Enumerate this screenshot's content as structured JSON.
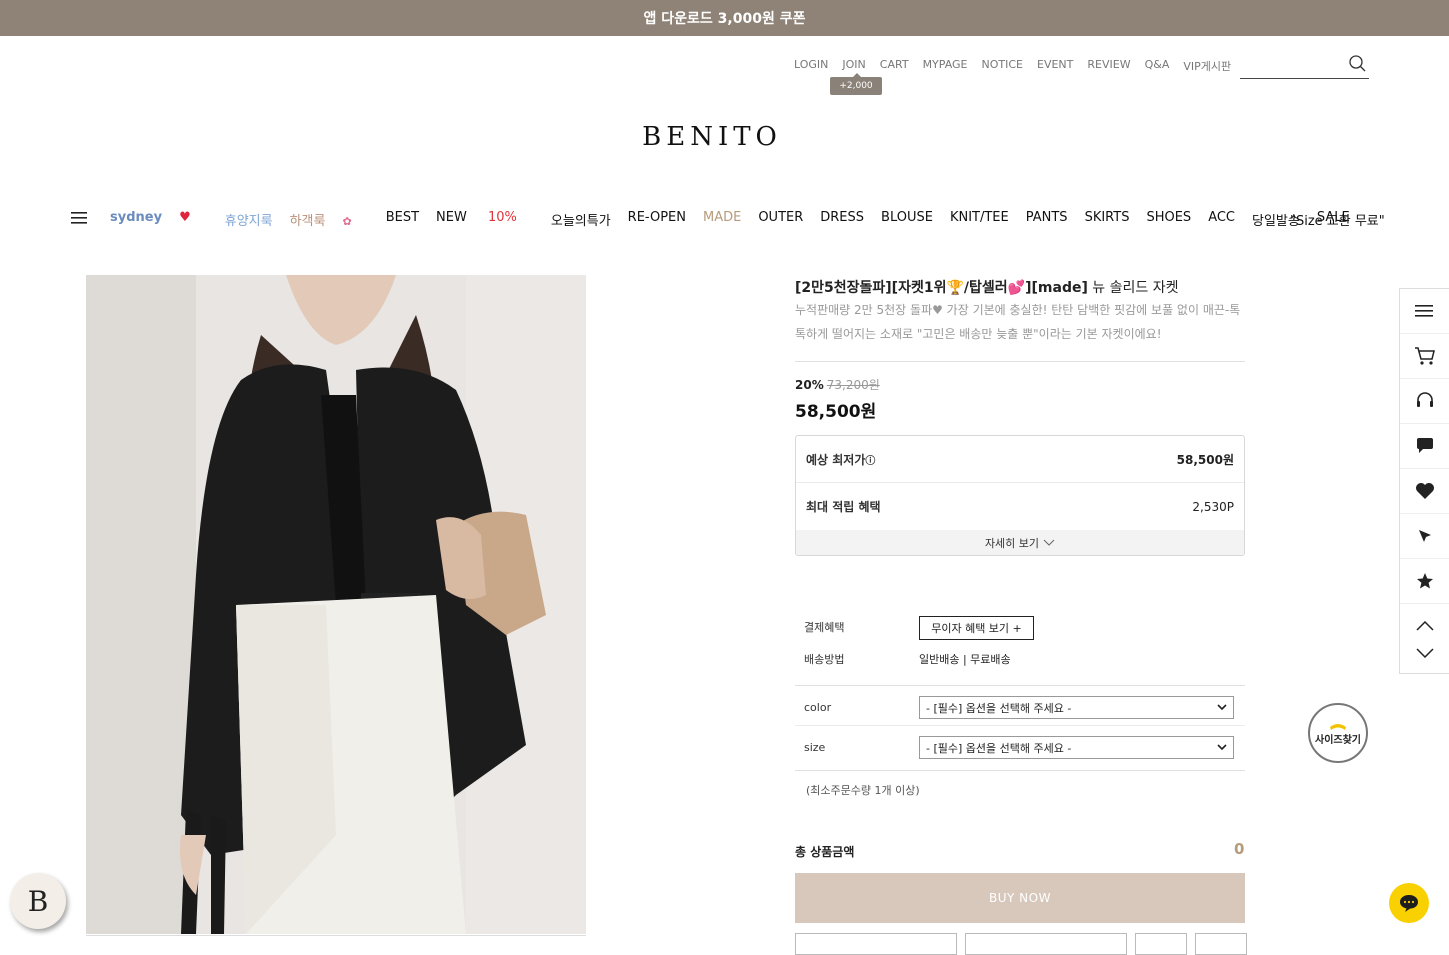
{
  "banner": {
    "text": "앱 다운로드 3,000원 쿠폰",
    "bg_color": "#8f8378"
  },
  "util_nav": {
    "items": [
      "LOGIN",
      "JOIN",
      "CART",
      "MYPAGE",
      "NOTICE",
      "EVENT",
      "REVIEW",
      "Q&A",
      "VIP게시판"
    ],
    "join_badge": "+2,000",
    "search_placeholder": ""
  },
  "logo": "BENITO",
  "main_nav": {
    "sydney": "sydney",
    "items": [
      "휴양지룩",
      "하객룩",
      "BEST",
      "NEW",
      "오늘의특가",
      "RE-OPEN",
      "MADE",
      "OUTER",
      "DRESS",
      "BLOUSE",
      "KNIT/TEE",
      "PANTS",
      "SKIRTS",
      "SHOES",
      "ACC",
      "당일발송",
      "SALE"
    ],
    "new_badge": "10%",
    "right_text": "\"Size 교환 무료\""
  },
  "product": {
    "title_bold": "[2만5천장돌파][자켓1위",
    "title_bold2": "/탑셀러",
    "title_bold3": "][made]",
    "title_rest": " 뉴 솔리드 자켓",
    "description": "누적판매량 2만 5천장 돌파♥ 가장 기본에 충실한! 탄탄 담백한 핏감에 보풀 없이 매끈-톡톡하게 떨어지는 소재로 \"고민은 배송만 늦출 뿐\"이라는 기본 자켓이에요!",
    "discount_pct": "20%",
    "original_price": "73,200원",
    "price": "58,500원"
  },
  "benefits": {
    "est_label": "예상 최저가",
    "est_value": "58,500원",
    "points_label": "최대 적립 혜택",
    "points_value": "2,530P",
    "more_label": "자세히 보기"
  },
  "payment": {
    "label": "결제혜택",
    "button": "무이자 혜택 보기 +"
  },
  "shipping": {
    "label": "배송방법",
    "value": "일반배송 | 무료배송"
  },
  "options": {
    "color_label": "color",
    "size_label": "size",
    "select_placeholder": "- [필수] 옵션을 선택해 주세요 -"
  },
  "min_order": "(최소주문수량 1개 이상)",
  "total": {
    "label": "총 상품금액",
    "value": "0"
  },
  "buy_now": "BUY NOW",
  "size_finder": "사이즈찾기",
  "b_badge": "B",
  "colors": {
    "accent_brown": "#b79c7c",
    "buy_button": "#d8c8bb",
    "chat_yellow": "#f9d000"
  }
}
